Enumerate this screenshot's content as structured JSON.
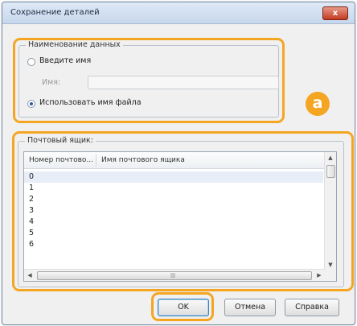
{
  "window": {
    "title": "Сохранение деталей",
    "close_label": "x"
  },
  "data_name_group": {
    "label": "Наименование данных",
    "option_enter_name": "Введите имя",
    "name_field_label": "Имя:",
    "name_field_value": "",
    "option_use_filename": "Использовать имя файла",
    "selected_option": "use_filename"
  },
  "callout": {
    "badge": "a"
  },
  "mailbox_group": {
    "label": "Почтовый ящик:",
    "columns": [
      "Номер почтово...",
      "Имя почтового ящика"
    ],
    "rows": [
      "0",
      "1",
      "2",
      "3",
      "4",
      "5",
      "6"
    ],
    "selected_row": 0,
    "scroll_grip": "|||"
  },
  "buttons": {
    "ok": "OK",
    "cancel": "Отмена",
    "help": "Справка"
  },
  "colors": {
    "highlight": "#f4a623",
    "title_bar": "#c7d7ec"
  }
}
